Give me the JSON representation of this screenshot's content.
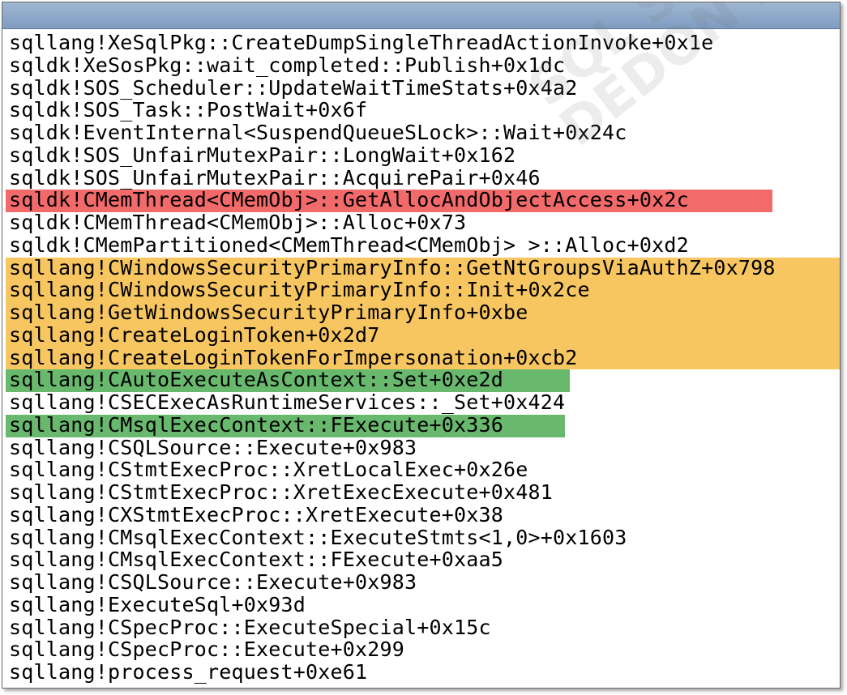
{
  "call_stack": [
    {
      "text": "sqllang!XeSqlPkg::CreateDumpSingleThreadActionInvoke+0x1e",
      "highlight": null
    },
    {
      "text": "sqldk!XeSosPkg::wait_completed::Publish+0x1dc",
      "highlight": null
    },
    {
      "text": "sqldk!SOS_Scheduler::UpdateWaitTimeStats+0x4a2",
      "highlight": null
    },
    {
      "text": "sqldk!SOS_Task::PostWait+0x6f",
      "highlight": null
    },
    {
      "text": "sqldk!EventInternal<SuspendQueueSLock>::Wait+0x24c",
      "highlight": null
    },
    {
      "text": "sqldk!SOS_UnfairMutexPair::LongWait+0x162",
      "highlight": null
    },
    {
      "text": "sqldk!SOS_UnfairMutexPair::AcquirePair+0x46",
      "highlight": null
    },
    {
      "text": "sqldk!CMemThread<CMemObj>::GetAllocAndObjectAccess+0x2c",
      "highlight": "red"
    },
    {
      "text": "sqldk!CMemThread<CMemObj>::Alloc+0x73",
      "highlight": null
    },
    {
      "text": "sqldk!CMemPartitioned<CMemThread<CMemObj> >::Alloc+0xd2",
      "highlight": null
    },
    {
      "text": "sqllang!CWindowsSecurityPrimaryInfo::GetNtGroupsViaAuthZ+0x798",
      "highlight": "orange"
    },
    {
      "text": "sqllang!CWindowsSecurityPrimaryInfo::Init+0x2ce",
      "highlight": "orange"
    },
    {
      "text": "sqllang!GetWindowsSecurityPrimaryInfo+0xbe",
      "highlight": "orange"
    },
    {
      "text": "sqllang!CreateLoginToken+0x2d7",
      "highlight": "orange"
    },
    {
      "text": "sqllang!CreateLoginTokenForImpersonation+0xcb2",
      "highlight": "orange"
    },
    {
      "text": "sqllang!CAutoExecuteAsContext::Set+0xe2d",
      "highlight": "green"
    },
    {
      "text": "sqllang!CSECExecAsRuntimeServices::_Set+0x424",
      "highlight": null
    },
    {
      "text": "sqllang!CMsqlExecContext::FExecute+0x336",
      "highlight": "green"
    },
    {
      "text": "sqllang!CSQLSource::Execute+0x983",
      "highlight": null
    },
    {
      "text": "sqllang!CStmtExecProc::XretLocalExec+0x26e",
      "highlight": null
    },
    {
      "text": "sqllang!CStmtExecProc::XretExecExecute+0x481",
      "highlight": null
    },
    {
      "text": "sqllang!CXStmtExecProc::XretExecute+0x38",
      "highlight": null
    },
    {
      "text": "sqllang!CMsqlExecContext::ExecuteStmts<1,0>+0x1603",
      "highlight": null
    },
    {
      "text": "sqllang!CMsqlExecContext::FExecute+0xaa5",
      "highlight": null
    },
    {
      "text": "sqllang!CSQLSource::Execute+0x983",
      "highlight": null
    },
    {
      "text": "sqllang!ExecuteSql+0x93d",
      "highlight": null
    },
    {
      "text": "sqllang!CSpecProc::ExecuteSpecial+0x15c",
      "highlight": null
    },
    {
      "text": "sqllang!CSpecProc::Execute+0x299",
      "highlight": null
    },
    {
      "text": "sqllang!process_request+0xe61",
      "highlight": null
    }
  ],
  "watermark": {
    "line1": "SQL SERVER",
    "line2": "DEDON LAB"
  },
  "colors": {
    "red": "#f36a6a",
    "orange": "#f7c661",
    "green": "#68b96d",
    "titlebar": "#8aa5c8"
  }
}
